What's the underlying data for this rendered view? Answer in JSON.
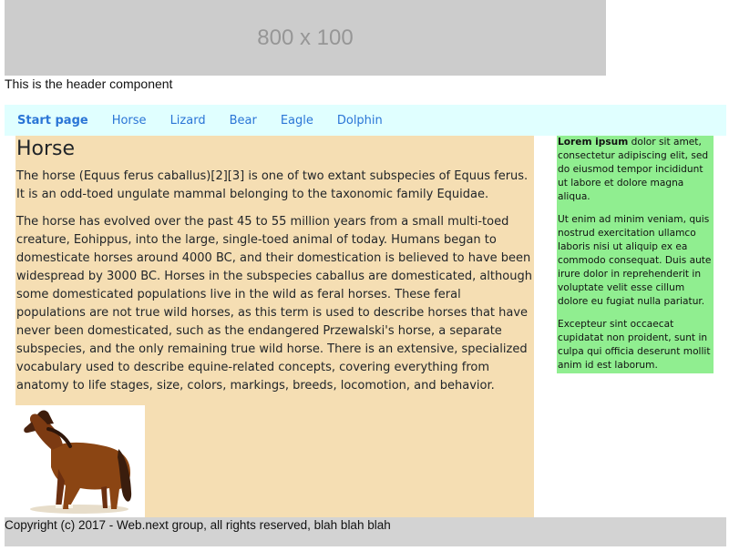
{
  "banner": {
    "placeholder_text": "800 x 100"
  },
  "header": {
    "text": "This is the header component"
  },
  "nav": {
    "items": [
      {
        "label": "Start page",
        "active": true
      },
      {
        "label": "Horse",
        "active": false
      },
      {
        "label": "Lizard",
        "active": false
      },
      {
        "label": "Bear",
        "active": false
      },
      {
        "label": "Eagle",
        "active": false
      },
      {
        "label": "Dolphin",
        "active": false
      }
    ]
  },
  "main": {
    "title": "Horse",
    "paragraphs": [
      "The horse (Equus ferus caballus)[2][3] is one of two extant subspecies of Equus ferus. It is an odd-toed ungulate mammal belonging to the taxonomic family Equidae.",
      "The horse has evolved over the past 45 to 55 million years from a small multi-toed creature, Eohippus, into the large, single-toed animal of today. Humans began to domesticate horses around 4000 BC, and their domestication is believed to have been widespread by 3000 BC. Horses in the subspecies caballus are domesticated, although some domesticated populations live in the wild as feral horses. These feral populations are not true wild horses, as this term is used to describe horses that have never been domesticated, such as the endangered Przewalski's horse, a separate subspecies, and the only remaining true wild horse. There is an extensive, specialized vocabulary used to describe equine-related concepts, covering everything from anatomy to life stages, size, colors, markings, breeds, locomotion, and behavior."
    ]
  },
  "aside": {
    "lead_bold": "Lorem ipsum",
    "lead_rest": " dolor sit amet, consectetur adipiscing elit, sed do eiusmod tempor incididunt ut labore et dolore magna aliqua.",
    "paragraph2": "Ut enim ad minim veniam, quis nostrud exercitation ullamco laboris nisi ut aliquip ex ea commodo consequat. Duis aute irure dolor in reprehenderit in voluptate velit esse cillum dolore eu fugiat nulla pariatur.",
    "paragraph3": "Excepteur sint occaecat cupidatat non proident, sunt in culpa qui officia deserunt mollit anim id est laborum."
  },
  "footer": {
    "text": "Copyright (c) 2017 - Web.next group, all rights reserved, blah blah blah"
  },
  "colors": {
    "banner_bg": "#cccccc",
    "nav_bg": "#e0ffff",
    "nav_link": "#2a75d6",
    "main_bg": "#f5deb3",
    "aside_bg": "#90ee90",
    "footer_bg": "#d3d3d3"
  }
}
